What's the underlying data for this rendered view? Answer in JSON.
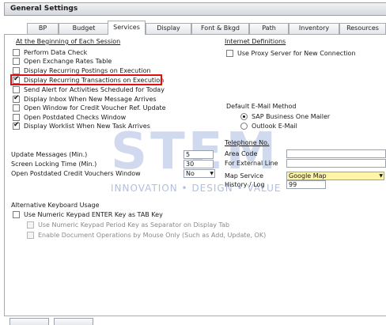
{
  "window": {
    "title": "General Settings"
  },
  "tabs": [
    {
      "label": "BP"
    },
    {
      "label": "Budget"
    },
    {
      "label": "Services"
    },
    {
      "label": "Display"
    },
    {
      "label": "Font & Bkgd"
    },
    {
      "label": "Path"
    },
    {
      "label": "Inventory"
    },
    {
      "label": "Resources"
    }
  ],
  "section_begin": {
    "header": "At the Beginning of Each Session",
    "options": [
      {
        "label": "Perform Data Check",
        "checked": false
      },
      {
        "label": "Open Exchange Rates Table",
        "checked": false
      },
      {
        "label": "Display Recurring Postings on Execution",
        "checked": false
      },
      {
        "label": "Display Recurring Transactions on Execution",
        "checked": true
      },
      {
        "label": "Send Alert for Activities Scheduled for Today",
        "checked": false
      },
      {
        "label": "Display Inbox When New Message Arrives",
        "checked": true
      },
      {
        "label": "Open Window for Credit Voucher Ref. Update",
        "checked": false
      },
      {
        "label": "Open Postdated Checks Window",
        "checked": false
      },
      {
        "label": "Display Worklist When New Task Arrives",
        "checked": true
      }
    ]
  },
  "internet": {
    "header": "Internet Definitions",
    "proxy_label": "Use Proxy Server for New Connection",
    "proxy_checked": false
  },
  "email": {
    "header": "Default E-Mail Method",
    "options": [
      {
        "label": "SAP Business One Mailer",
        "selected": true
      },
      {
        "label": "Outlook E-Mail",
        "selected": false
      }
    ]
  },
  "telephone": {
    "header": "Telephone No.",
    "area_code_label": "Area Code",
    "area_code_value": "",
    "external_line_label": "For External Line",
    "external_line_value": ""
  },
  "map": {
    "service_label": "Map Service",
    "service_value": "Google Map",
    "history_label": "History / Log",
    "history_value": "99"
  },
  "timing": {
    "update_label": "Update Messages (Min.)",
    "update_value": "5",
    "lock_label": "Screen Locking Time (Min.)",
    "lock_value": "30",
    "postdated_label": "Open Postdated Credit Vouchers Window",
    "postdated_value": "No"
  },
  "keyboard": {
    "header": "Alternative Keyboard Usage",
    "enter_tab_label": "Use Numeric Keypad ENTER Key as TAB Key",
    "enter_tab_checked": false,
    "period_label": "Use Numeric Keypad Period Key as Separator on Display Tab",
    "period_checked": false,
    "mouse_label": "Enable Document Operations by Mouse Only (Such as Add, Update, OK)",
    "mouse_checked": false
  },
  "watermark": {
    "brand": "STEM",
    "tagline": "INNOVATION • DESIGN • VALUE"
  },
  "colors": {
    "highlight": "#e01010",
    "map_field": "#fff5a8",
    "watermark": "#96aad7"
  }
}
